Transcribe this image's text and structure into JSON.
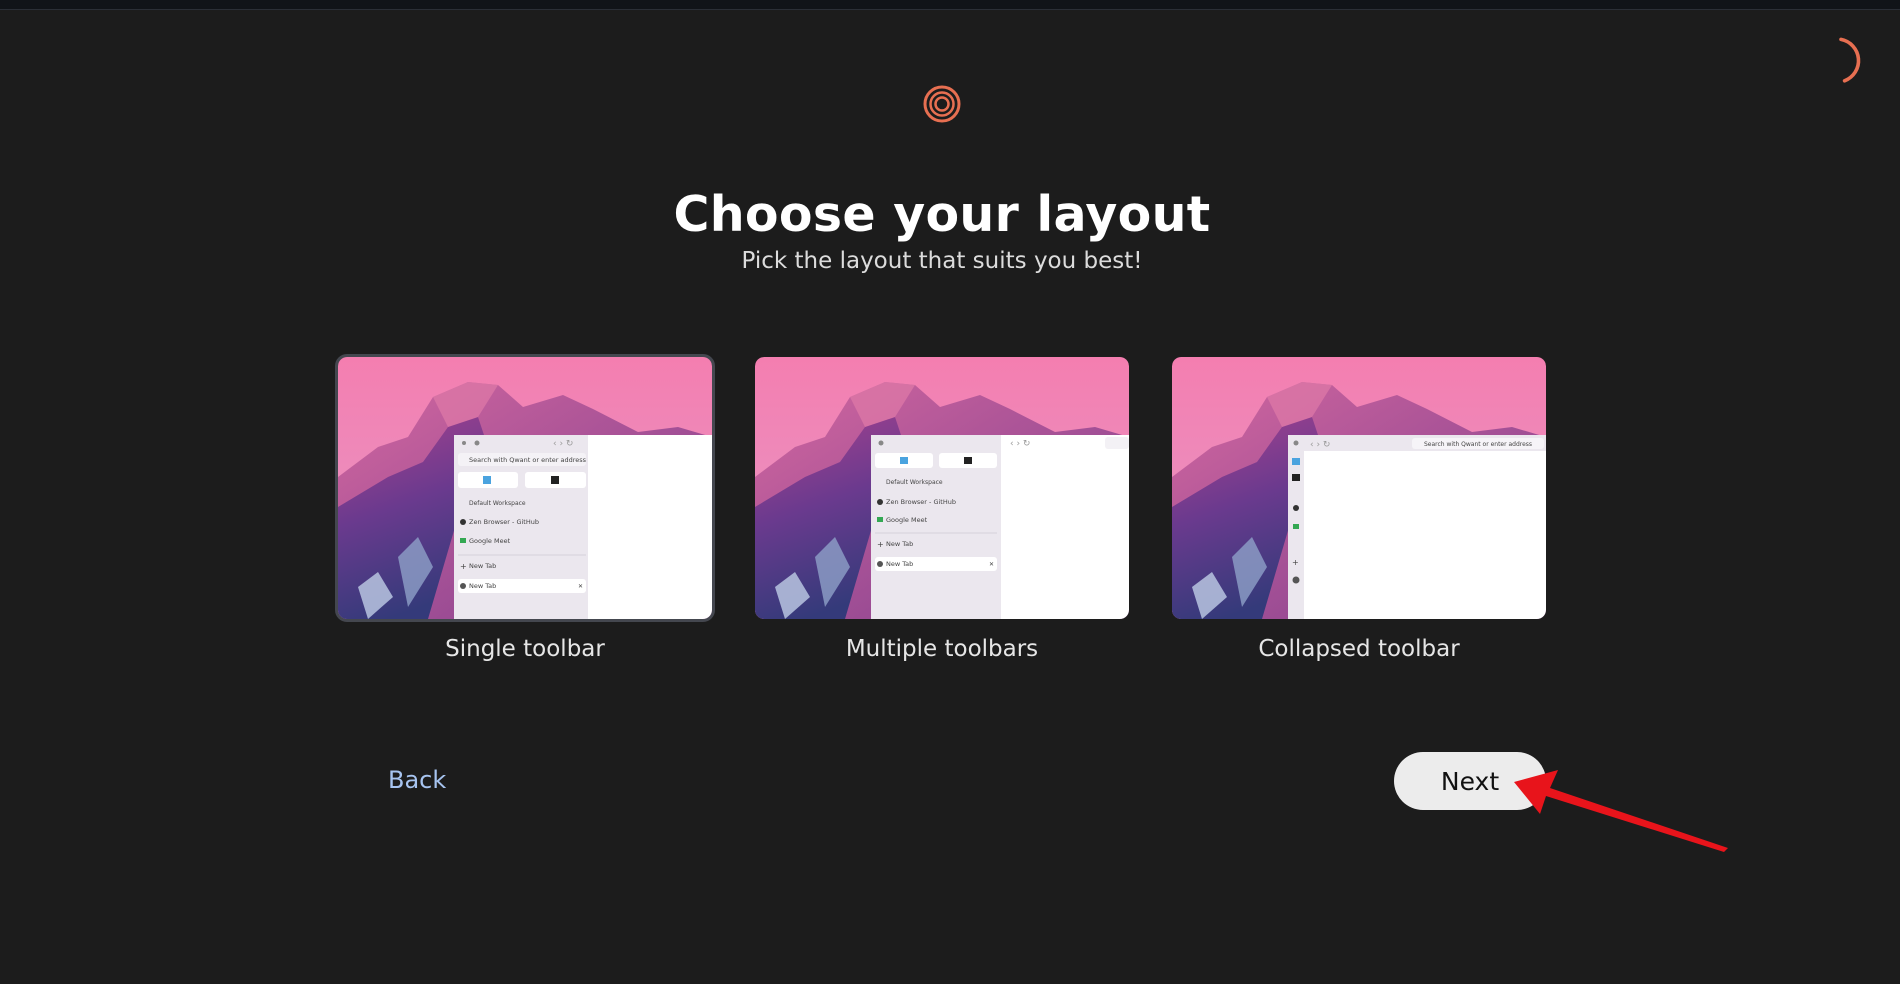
{
  "header": {
    "title": "Choose your layout",
    "subtitle": "Pick the layout that suits you best!"
  },
  "layouts": [
    {
      "label": "Single toolbar",
      "selected": true
    },
    {
      "label": "Multiple toolbars",
      "selected": false
    },
    {
      "label": "Collapsed toolbar",
      "selected": false
    }
  ],
  "preview_text": {
    "search": "Search with Qwant or enter address",
    "workspace": "Default Workspace",
    "tab_github": "Zen Browser - GitHub",
    "tab_meet": "Google Meet",
    "new_tab": "New Tab",
    "close_glyph": "✕",
    "plus_glyph": "+"
  },
  "nav": {
    "back_label": "Back",
    "next_label": "Next"
  },
  "colors": {
    "accent": "#e76f51",
    "annotation_arrow": "#e8141b",
    "background": "#1c1c1c"
  }
}
